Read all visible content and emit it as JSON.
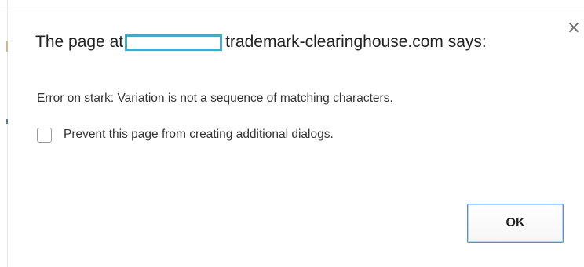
{
  "dialog": {
    "title_prefix": "The page at",
    "title_suffix": "trademark-clearinghouse.com says:",
    "close_glyph": "×",
    "message": "Error on stark: Variation is not a sequence of matching characters.",
    "suppress_checkbox": {
      "label": "Prevent this page from creating additional dialogs.",
      "checked": false
    },
    "ok_label": "OK"
  },
  "colors": {
    "redaction_border": "#4aa8c2",
    "ok_border": "#5b8fd8",
    "text": "#222222"
  }
}
